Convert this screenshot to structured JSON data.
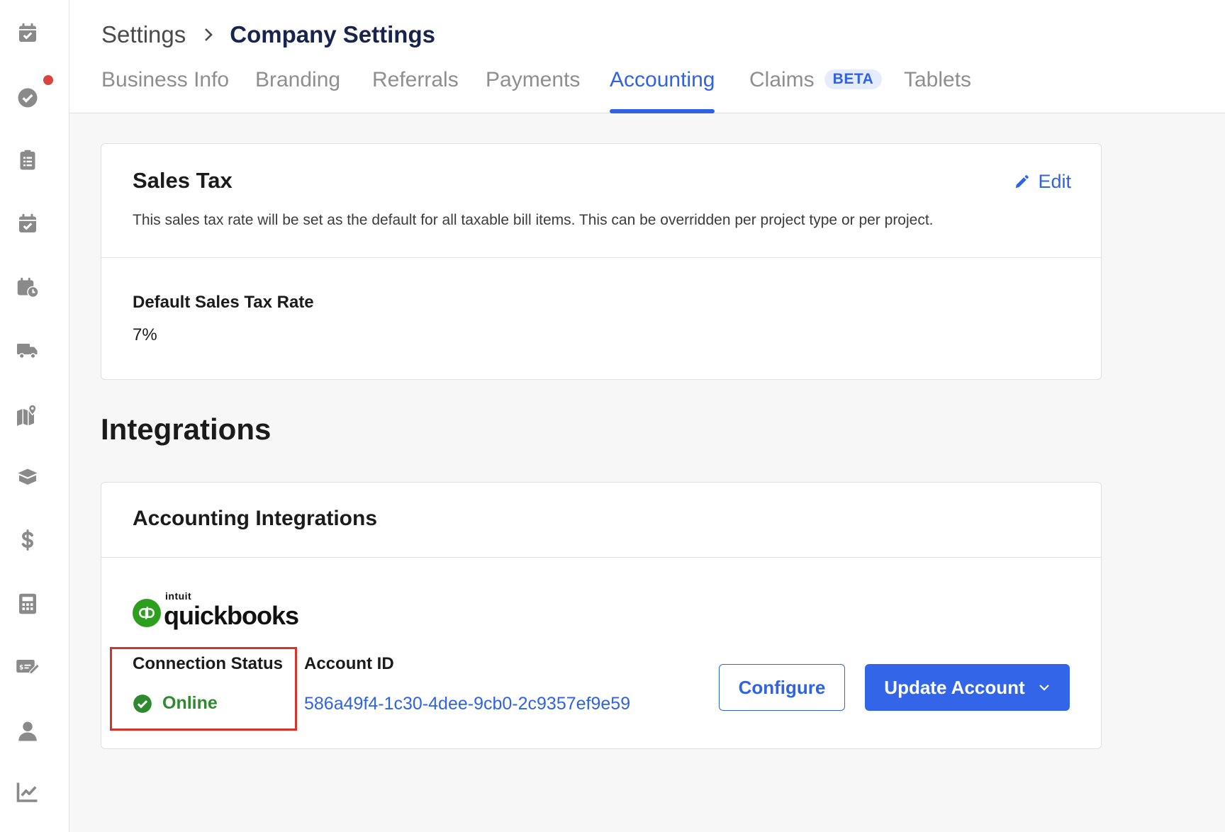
{
  "breadcrumb": {
    "root": "Settings",
    "current": "Company Settings"
  },
  "tabs": [
    {
      "label": "Business Info",
      "active": false
    },
    {
      "label": "Branding",
      "active": false
    },
    {
      "label": "Referrals",
      "active": false
    },
    {
      "label": "Payments",
      "active": false
    },
    {
      "label": "Accounting",
      "active": true
    },
    {
      "label": "Claims",
      "badge": "BETA",
      "active": false
    },
    {
      "label": "Tablets",
      "active": false
    }
  ],
  "sidebar": {
    "icons": [
      "calendar-check-icon",
      "check-circle-icon",
      "clipboard-list-icon",
      "calendar-check-icon",
      "calendar-clock-icon",
      "truck-icon",
      "map-marker-icon",
      "open-box-icon",
      "dollar-icon",
      "calculator-icon",
      "money-check-edit-icon",
      "user-icon",
      "chart-line-icon"
    ]
  },
  "sales_tax": {
    "title": "Sales Tax",
    "edit_label": "Edit",
    "description": "This sales tax rate will be set as the default for all taxable bill items. This can be overridden per project type or per project.",
    "rate_label": "Default Sales Tax Rate",
    "rate_value": "7%"
  },
  "integrations": {
    "heading": "Integrations",
    "card_title": "Accounting Integrations",
    "provider": {
      "brand_top": "intuit",
      "brand_name": "quickbooks"
    },
    "connection_status_label": "Connection Status",
    "connection_status_value": "Online",
    "account_id_label": "Account ID",
    "account_id_value": "586a49f4-1c30-4dee-9cb0-2c9357ef9e59",
    "configure_label": "Configure",
    "update_label": "Update Account"
  },
  "colors": {
    "accent": "#2f63e4",
    "success": "#2e8a2e",
    "highlight": "#d8322b",
    "notification": "#d8463c",
    "icon_gray": "#8a8a8a",
    "quickbooks_green": "#2ca01c"
  }
}
